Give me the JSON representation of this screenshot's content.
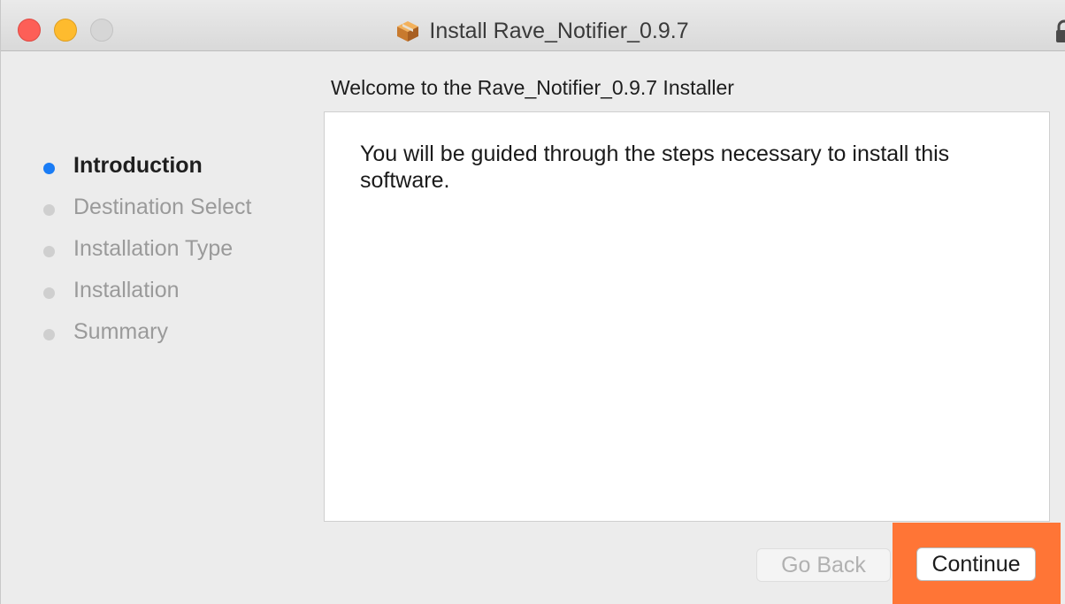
{
  "window": {
    "title": "Install Rave_Notifier_0.9.7"
  },
  "heading": "Welcome to the Rave_Notifier_0.9.7 Installer",
  "steps": [
    {
      "label": "Introduction",
      "active": true
    },
    {
      "label": "Destination Select",
      "active": false
    },
    {
      "label": "Installation Type",
      "active": false
    },
    {
      "label": "Installation",
      "active": false
    },
    {
      "label": "Summary",
      "active": false
    }
  ],
  "content": {
    "message": "You will be guided through the steps necessary to install this software."
  },
  "buttons": {
    "back_label": "Go Back",
    "continue_label": "Continue"
  },
  "colors": {
    "active_step_dot": "#1a7cf5",
    "inactive_step_dot": "#cfcfcf",
    "highlight": "#ff7536",
    "close": "#fd5f57",
    "minimize": "#febb2e",
    "zoom": "#d6d6d6"
  },
  "icons": {
    "title_icon": "package-icon",
    "lock_icon": "lock-icon"
  }
}
